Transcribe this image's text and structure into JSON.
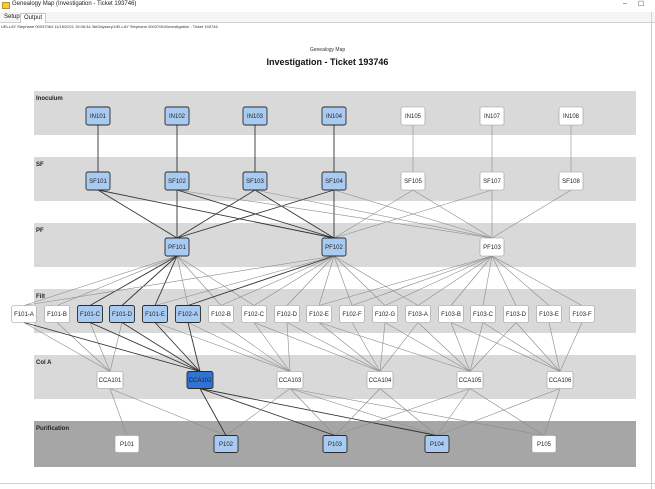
{
  "window": {
    "title": "Genealogy Map (Investigation - Ticket 193746)",
    "minimize_glyph": "–",
    "maximize_glyph": "☐",
    "icon": "app-folder-icon"
  },
  "menu": {
    "tabs": [
      {
        "label": "Setup",
        "active": false
      },
      {
        "label": "Output",
        "active": true
      }
    ]
  },
  "info_line": "UELLAY Stephane 00037064 11/16/2021 15:06:34 /IbiOdyssey/UELLAY Stephane 00037064/investigation - Ticket 193746",
  "map": {
    "subtitle": "Genealogy Map",
    "title": "Investigation - Ticket 193746"
  },
  "colors": {
    "band": "#d9d9d9",
    "band_purification": "#a6a6a6",
    "node_plain": "#ffffff",
    "node_highlight": "#a9cbf2",
    "node_selected": "#2f73d4",
    "edge": "#8c8c8c",
    "edge_highlight": "#333333"
  },
  "bands": [
    {
      "id": "inoculum",
      "label": "Inoculum"
    },
    {
      "id": "sf",
      "label": "SF"
    },
    {
      "id": "pf",
      "label": "PF"
    },
    {
      "id": "filt",
      "label": "Filt"
    },
    {
      "id": "cola",
      "label": "Col A"
    },
    {
      "id": "purification",
      "label": "Purification"
    }
  ],
  "nodes": {
    "inoculum": [
      {
        "label": "IN101",
        "state": "highlight"
      },
      {
        "label": "IN102",
        "state": "highlight"
      },
      {
        "label": "IN103",
        "state": "highlight"
      },
      {
        "label": "IN104",
        "state": "highlight"
      },
      {
        "label": "IN105",
        "state": "plain"
      },
      {
        "label": "IN107",
        "state": "plain"
      },
      {
        "label": "IN108",
        "state": "plain"
      }
    ],
    "sf": [
      {
        "label": "SF101",
        "state": "highlight"
      },
      {
        "label": "SF102",
        "state": "highlight"
      },
      {
        "label": "SF103",
        "state": "highlight"
      },
      {
        "label": "SF104",
        "state": "highlight"
      },
      {
        "label": "SF105",
        "state": "plain"
      },
      {
        "label": "SF107",
        "state": "plain"
      },
      {
        "label": "SF108",
        "state": "plain"
      }
    ],
    "pf": [
      {
        "label": "PF101",
        "state": "highlight"
      },
      {
        "label": "PF102",
        "state": "highlight"
      },
      {
        "label": "PF103",
        "state": "plain"
      }
    ],
    "filt": [
      {
        "label": "F101-A",
        "state": "plain"
      },
      {
        "label": "F101-B",
        "state": "plain"
      },
      {
        "label": "F101-C",
        "state": "highlight"
      },
      {
        "label": "F101-D",
        "state": "highlight"
      },
      {
        "label": "F101-E",
        "state": "highlight"
      },
      {
        "label": "F102-A",
        "state": "highlight"
      },
      {
        "label": "F102-B",
        "state": "plain"
      },
      {
        "label": "F102-C",
        "state": "plain"
      },
      {
        "label": "F102-D",
        "state": "plain"
      },
      {
        "label": "F102-E",
        "state": "plain"
      },
      {
        "label": "F102-F",
        "state": "plain"
      },
      {
        "label": "F102-G",
        "state": "plain"
      },
      {
        "label": "F103-A",
        "state": "plain"
      },
      {
        "label": "F103-B",
        "state": "plain"
      },
      {
        "label": "F103-C",
        "state": "plain"
      },
      {
        "label": "F103-D",
        "state": "plain"
      },
      {
        "label": "F103-E",
        "state": "plain"
      },
      {
        "label": "F103-F",
        "state": "plain"
      }
    ],
    "cola": [
      {
        "label": "CCA101",
        "state": "plain"
      },
      {
        "label": "CCA102",
        "state": "selected"
      },
      {
        "label": "CCA103",
        "state": "plain"
      },
      {
        "label": "CCA104",
        "state": "plain"
      },
      {
        "label": "CCA105",
        "state": "plain"
      },
      {
        "label": "CCA106",
        "state": "plain"
      }
    ],
    "purification": [
      {
        "label": "P101",
        "state": "plain"
      },
      {
        "label": "P102",
        "state": "highlight"
      },
      {
        "label": "P103",
        "state": "highlight"
      },
      {
        "label": "P104",
        "state": "highlight"
      },
      {
        "label": "P105",
        "state": "plain"
      }
    ]
  },
  "edges": [
    [
      "IN101",
      "SF101",
      1
    ],
    [
      "IN102",
      "SF102",
      1
    ],
    [
      "IN103",
      "SF103",
      1
    ],
    [
      "IN104",
      "SF104",
      1
    ],
    [
      "IN105",
      "SF105",
      0
    ],
    [
      "IN107",
      "SF107",
      0
    ],
    [
      "IN108",
      "SF108",
      0
    ],
    [
      "SF101",
      "PF101",
      1
    ],
    [
      "SF102",
      "PF101",
      1
    ],
    [
      "SF103",
      "PF101",
      1
    ],
    [
      "SF104",
      "PF101",
      1
    ],
    [
      "SF101",
      "PF102",
      1
    ],
    [
      "SF102",
      "PF102",
      1
    ],
    [
      "SF103",
      "PF102",
      1
    ],
    [
      "SF104",
      "PF102",
      1
    ],
    [
      "SF105",
      "PF102",
      0
    ],
    [
      "SF107",
      "PF102",
      0
    ],
    [
      "SF102",
      "PF103",
      0
    ],
    [
      "SF103",
      "PF103",
      0
    ],
    [
      "SF104",
      "PF103",
      0
    ],
    [
      "SF105",
      "PF103",
      0
    ],
    [
      "SF107",
      "PF103",
      0
    ],
    [
      "SF108",
      "PF103",
      0
    ],
    [
      "PF101",
      "F101-A",
      0
    ],
    [
      "PF101",
      "F101-B",
      0
    ],
    [
      "PF101",
      "F101-C",
      1
    ],
    [
      "PF101",
      "F101-D",
      1
    ],
    [
      "PF101",
      "F101-E",
      1
    ],
    [
      "PF101",
      "F102-A",
      0
    ],
    [
      "PF101",
      "F102-B",
      0
    ],
    [
      "PF101",
      "F102-C",
      0
    ],
    [
      "PF102",
      "F101-E",
      0
    ],
    [
      "PF102",
      "F102-A",
      1
    ],
    [
      "PF102",
      "F102-B",
      0
    ],
    [
      "PF102",
      "F102-C",
      0
    ],
    [
      "PF102",
      "F102-D",
      0
    ],
    [
      "PF102",
      "F102-E",
      0
    ],
    [
      "PF102",
      "F102-F",
      0
    ],
    [
      "PF102",
      "F102-G",
      0
    ],
    [
      "PF102",
      "F101-A",
      0
    ],
    [
      "PF102",
      "F103-A",
      0
    ],
    [
      "PF103",
      "F102-E",
      0
    ],
    [
      "PF103",
      "F102-F",
      0
    ],
    [
      "PF103",
      "F102-G",
      0
    ],
    [
      "PF103",
      "F103-A",
      0
    ],
    [
      "PF103",
      "F103-B",
      0
    ],
    [
      "PF103",
      "F103-C",
      0
    ],
    [
      "PF103",
      "F103-D",
      0
    ],
    [
      "PF103",
      "F103-E",
      0
    ],
    [
      "PF103",
      "F103-F",
      0
    ],
    [
      "F101-A",
      "CCA101",
      0
    ],
    [
      "F101-B",
      "CCA101",
      0
    ],
    [
      "F101-C",
      "CCA101",
      0
    ],
    [
      "F101-D",
      "CCA101",
      0
    ],
    [
      "F101-A",
      "CCA102",
      1
    ],
    [
      "F101-C",
      "CCA102",
      1
    ],
    [
      "F101-D",
      "CCA102",
      1
    ],
    [
      "F101-E",
      "CCA102",
      1
    ],
    [
      "F102-A",
      "CCA102",
      1
    ],
    [
      "F101-E",
      "CCA103",
      0
    ],
    [
      "F102-A",
      "CCA103",
      0
    ],
    [
      "F102-B",
      "CCA103",
      0
    ],
    [
      "F102-C",
      "CCA103",
      0
    ],
    [
      "F102-D",
      "CCA103",
      0
    ],
    [
      "F102-C",
      "CCA104",
      0
    ],
    [
      "F102-D",
      "CCA104",
      0
    ],
    [
      "F102-E",
      "CCA104",
      0
    ],
    [
      "F102-F",
      "CCA104",
      0
    ],
    [
      "F102-G",
      "CCA104",
      0
    ],
    [
      "F103-A",
      "CCA104",
      0
    ],
    [
      "F102-G",
      "CCA105",
      0
    ],
    [
      "F103-A",
      "CCA105",
      0
    ],
    [
      "F103-B",
      "CCA105",
      0
    ],
    [
      "F103-C",
      "CCA105",
      0
    ],
    [
      "F103-D",
      "CCA105",
      0
    ],
    [
      "F102-E",
      "CCA105",
      0
    ],
    [
      "F103-B",
      "CCA106",
      0
    ],
    [
      "F103-C",
      "CCA106",
      0
    ],
    [
      "F103-D",
      "CCA106",
      0
    ],
    [
      "F103-E",
      "CCA106",
      0
    ],
    [
      "F103-F",
      "CCA106",
      0
    ],
    [
      "CCA101",
      "P101",
      0
    ],
    [
      "CCA101",
      "P102",
      0
    ],
    [
      "CCA102",
      "P102",
      1
    ],
    [
      "CCA102",
      "P103",
      1
    ],
    [
      "CCA102",
      "P104",
      1
    ],
    [
      "CCA103",
      "P102",
      0
    ],
    [
      "CCA103",
      "P103",
      0
    ],
    [
      "CCA103",
      "P104",
      0
    ],
    [
      "CCA103",
      "P105",
      0
    ],
    [
      "CCA104",
      "P103",
      0
    ],
    [
      "CCA104",
      "P104",
      0
    ],
    [
      "CCA105",
      "P103",
      0
    ],
    [
      "CCA105",
      "P104",
      0
    ],
    [
      "CCA105",
      "P105",
      0
    ],
    [
      "CCA106",
      "P105",
      0
    ],
    [
      "CCA106",
      "P104",
      0
    ]
  ]
}
